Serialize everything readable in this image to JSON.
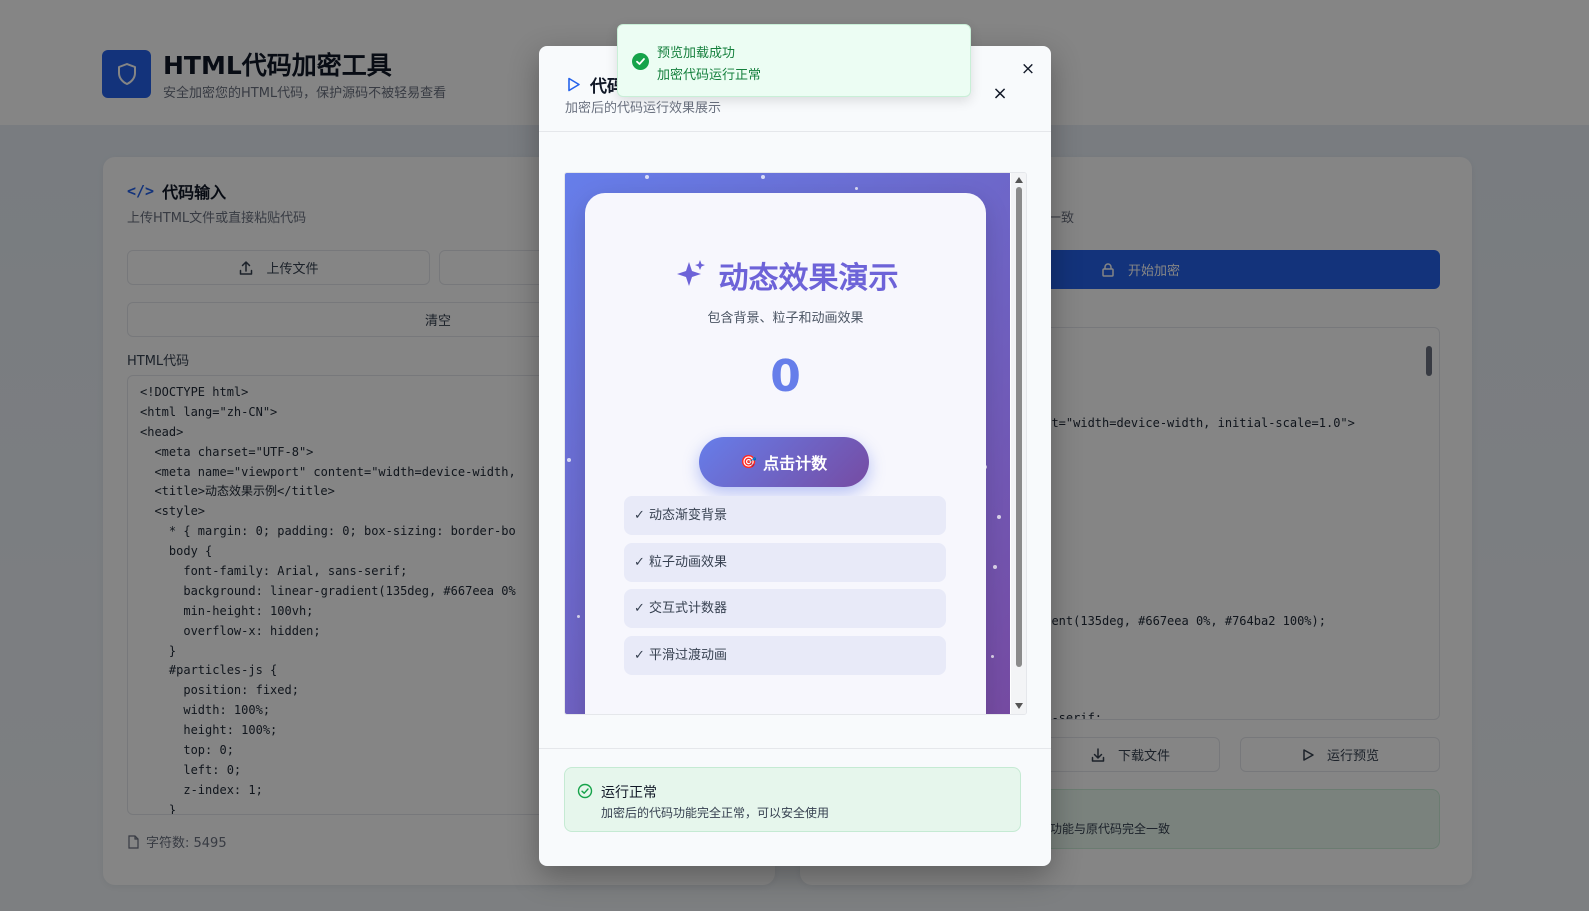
{
  "app": {
    "title": "HTML代码加密工具",
    "subtitle": "安全加密您的HTML代码，保护源码不被轻易查看"
  },
  "input_panel": {
    "title": "代码输入",
    "description": "上传HTML文件或直接粘贴代码",
    "upload_label": "上传文件",
    "clear_label": "清空",
    "code_label": "HTML代码",
    "code_lines": [
      "<!DOCTYPE html>",
      "<html lang=\"zh-CN\">",
      "<head>",
      "  <meta charset=\"UTF-8\">",
      "  <meta name=\"viewport\" content=\"width=device-width,",
      "  <title>动态效果示例</title>",
      "  <style>",
      "    * { margin: 0; padding: 0; box-sizing: border-bo",
      "    body {",
      "      font-family: Arial, sans-serif;",
      "      background: linear-gradient(135deg, #667eea 0%",
      "      min-height: 100vh;",
      "      overflow-x: hidden;",
      "    }",
      "    #particles-js {",
      "      position: fixed;",
      "      width: 100%;",
      "      height: 100%;",
      "      top: 0;",
      "      left: 0;",
      "      z-index: 1;",
      "    }"
    ],
    "char_count": "字符数: 5495"
  },
  "output_panel": {
    "description_fragment": "一致",
    "encrypt_label": "开始加密",
    "code_fragments": [
      "ent=\"width=device-width, initial-scale=1.0\">",
      "dient(135deg, #667eea 0%, #764ba2 100%);",
      "r;",
      "ns-serif;"
    ],
    "download_label": "下载文件",
    "run_label": "运行预览",
    "note_fragment": "功能与原代码完全一致"
  },
  "modal": {
    "title": "代码",
    "description": "加密后的代码运行效果展示",
    "close_symbol": "×"
  },
  "preview": {
    "title": "动态效果演示",
    "subtitle": "包含背景、粒子和动画效果",
    "counter": "0",
    "button_label": "点击计数",
    "features": [
      "✓ 动态渐变背景",
      "✓ 粒子动画效果",
      "✓ 交互式计数器",
      "✓ 平滑过渡动画"
    ],
    "colors": {
      "start": "#667eea",
      "end": "#764ba2"
    }
  },
  "status": {
    "title": "运行正常",
    "description": "加密后的代码功能完全正常，可以安全使用"
  },
  "toast": {
    "title": "预览加载成功",
    "description": "加密代码运行正常"
  }
}
